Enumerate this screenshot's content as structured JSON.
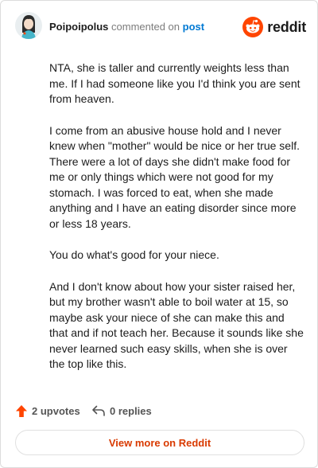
{
  "header": {
    "author": "Poipoipolus",
    "commented_on": "commented on",
    "post_link": "post",
    "brand": "reddit"
  },
  "comment": {
    "paragraphs": [
      "NTA, she is taller and currently weights less than me. If I had someone like you I'd think you are sent from heaven.",
      "I come from an abusive house hold and I never knew when \"mother\" would be nice or her true self. There were a lot of days she didn't make food for me or only things which were not good for my stomach. I was forced to eat, when she made anything and I have an eating disorder since more or less 18 years.",
      "You do what's good for your niece.",
      "And I don't know about how your sister raised her, but my brother wasn't able to boil water at 15, so maybe ask your niece of she can make this and that and if not teach her. Because it sounds like she never learned such easy skills, when she is over the top like this."
    ]
  },
  "footer": {
    "upvotes": "2 upvotes",
    "replies": "0 replies",
    "view_more": "View more on Reddit"
  },
  "colors": {
    "brand_orange": "#ff4500",
    "link_blue": "#0079d3",
    "view_more_text": "#d93a00"
  },
  "icons": {
    "avatar": "avatar",
    "brand_logo": "reddit-snoo-icon",
    "upvote": "upvote-arrow-icon",
    "reply": "reply-arrow-icon"
  }
}
